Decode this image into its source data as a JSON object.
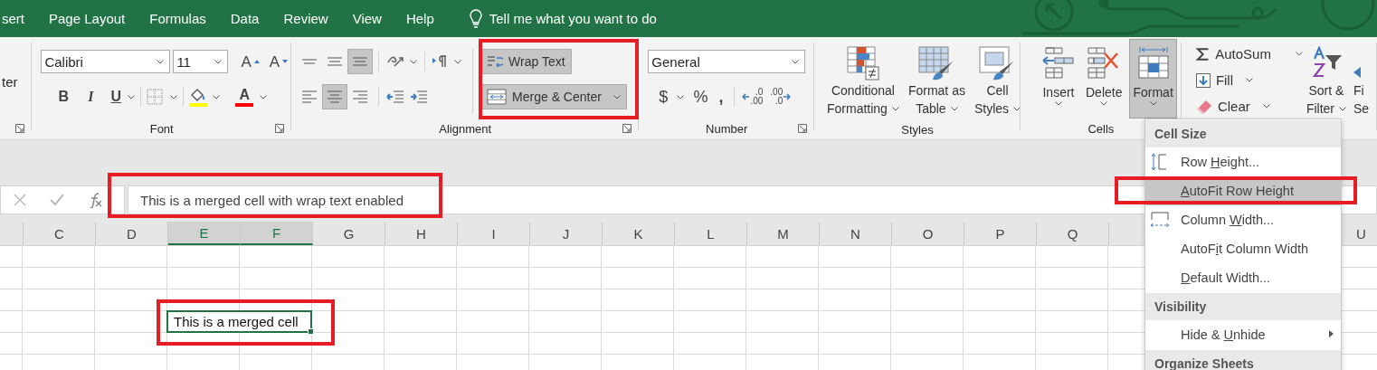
{
  "menu_bar": {
    "tabs": [
      {
        "label": "sert"
      },
      {
        "label": "Page Layout"
      },
      {
        "label": "Formulas"
      },
      {
        "label": "Data"
      },
      {
        "label": "Review"
      },
      {
        "label": "View"
      },
      {
        "label": "Help"
      }
    ],
    "tell_me": "Tell me what you want to do"
  },
  "ribbon": {
    "fragment": {
      "text": "ter"
    },
    "font": {
      "label": "Font",
      "font_name": "Calibri",
      "font_size": "11",
      "grow": "A",
      "shrink": "A",
      "bold": "B",
      "italic": "I",
      "underline": "U",
      "color_letter": "A"
    },
    "alignment": {
      "label": "Alignment",
      "vertical": [
        {
          "kind": "top",
          "selected": false
        },
        {
          "kind": "middle",
          "selected": false
        },
        {
          "kind": "bottom",
          "selected": true
        }
      ],
      "horizontal": [
        {
          "kind": "left",
          "selected": false
        },
        {
          "kind": "center",
          "selected": true
        },
        {
          "kind": "right",
          "selected": false
        }
      ],
      "wrap_text": {
        "label": "Wrap Text",
        "selected": true
      },
      "merge_center": {
        "label": "Merge & Center",
        "selected": true
      }
    },
    "number": {
      "label": "Number",
      "format": "General",
      "currency": "$",
      "percent": "%",
      "comma": ",",
      "decimals": [
        {
          "kind": "increase",
          "top": ".0",
          "bottom": ".00"
        },
        {
          "kind": "decrease",
          "top": ".00",
          "bottom": ".0"
        }
      ]
    },
    "styles": {
      "label": "Styles",
      "buttons": [
        {
          "kind": "conditional",
          "label_lines": [
            "Conditional",
            "Formatting"
          ]
        },
        {
          "kind": "table",
          "label_lines": [
            "Format as",
            "Table"
          ]
        },
        {
          "kind": "cell-styles",
          "label_lines": [
            "Cell",
            "Styles"
          ]
        }
      ]
    },
    "cells": {
      "label": "Cells",
      "buttons": [
        {
          "kind": "insert",
          "label": "Insert",
          "selected": false
        },
        {
          "kind": "delete",
          "label": "Delete",
          "selected": false
        },
        {
          "kind": "format",
          "label": "Format",
          "selected": true
        }
      ]
    },
    "editing": {
      "items": [
        {
          "kind": "autosum",
          "label": "AutoSum"
        },
        {
          "kind": "fill",
          "label": "Fill"
        },
        {
          "kind": "clear",
          "label": "Clear"
        }
      ],
      "sort": {
        "label_lines": [
          "Sort &",
          "Filter"
        ]
      },
      "find": {
        "label_lines": [
          "Fi",
          "Se"
        ]
      }
    }
  },
  "formula_bar": {
    "value": "This is a merged cell with wrap text enabled"
  },
  "sheet": {
    "columns": [
      {
        "label": "C",
        "selected": false
      },
      {
        "label": "D",
        "selected": false
      },
      {
        "label": "E",
        "selected": true
      },
      {
        "label": "F",
        "selected": true
      },
      {
        "label": "G",
        "selected": false
      },
      {
        "label": "H",
        "selected": false
      },
      {
        "label": "I",
        "selected": false
      },
      {
        "label": "J",
        "selected": false
      },
      {
        "label": "K",
        "selected": false
      },
      {
        "label": "L",
        "selected": false
      },
      {
        "label": "M",
        "selected": false
      },
      {
        "label": "N",
        "selected": false
      },
      {
        "label": "O",
        "selected": false
      },
      {
        "label": "P",
        "selected": false
      },
      {
        "label": "Q",
        "selected": false
      },
      {
        "label": "U",
        "selected": false
      }
    ],
    "merged_cell": {
      "value": "This is a merged cell"
    }
  },
  "format_menu": {
    "sections": [
      {
        "heading": "Cell Size",
        "items": [
          {
            "kind": "row-height",
            "label": {
              "before": "Row ",
              "key": "H",
              "after": "eight..."
            },
            "selected": false,
            "submenu": false
          },
          {
            "kind": "plain",
            "label": {
              "key": "A",
              "after": "utoFit Row Height"
            },
            "selected": true,
            "submenu": false
          },
          {
            "kind": "column-width",
            "label": {
              "before": "Column ",
              "key": "W",
              "after": "idth..."
            },
            "selected": false,
            "submenu": false
          },
          {
            "kind": "plain",
            "label": {
              "before": "AutoF",
              "key": "i",
              "after": "t Column Width"
            },
            "selected": false,
            "submenu": false
          },
          {
            "kind": "plain",
            "label": {
              "key": "D",
              "after": "efault Width..."
            },
            "selected": false,
            "submenu": false
          }
        ]
      },
      {
        "heading": "Visibility",
        "items": [
          {
            "kind": "plain",
            "label": {
              "before": "Hide & ",
              "key": "U",
              "after": "nhide"
            },
            "selected": false,
            "submenu": true
          }
        ]
      },
      {
        "heading": "Organize Sheets"
      }
    ]
  },
  "highlights": [
    {
      "kind": "alignment-buttons"
    },
    {
      "kind": "formula-field"
    },
    {
      "kind": "merged-cell"
    },
    {
      "kind": "menu-item"
    }
  ]
}
